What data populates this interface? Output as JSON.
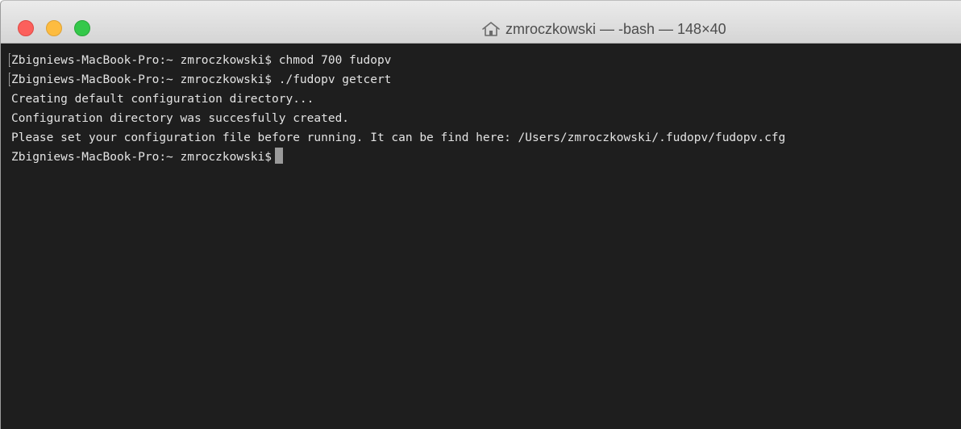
{
  "window": {
    "title": "zmroczkowski — -bash — 148×40",
    "title_icon": "home-icon",
    "traffic_lights": {
      "close": "#fc605c",
      "minimize": "#fdbc40",
      "zoom": "#34c84a"
    }
  },
  "terminal": {
    "background": "#1e1e1e",
    "foreground": "#e3e3e3",
    "lines": [
      "Zbigniews-MacBook-Pro:~ zmroczkowski$ chmod 700 fudopv",
      "Zbigniews-MacBook-Pro:~ zmroczkowski$ ./fudopv getcert",
      "Creating default configuration directory...",
      "Configuration directory was succesfully created.",
      "Please set your configuration file before running. It can be find here: /Users/zmroczkowski/.fudopv/fudopv.cfg"
    ],
    "prompt": "Zbigniews-MacBook-Pro:~ zmroczkowski$"
  }
}
